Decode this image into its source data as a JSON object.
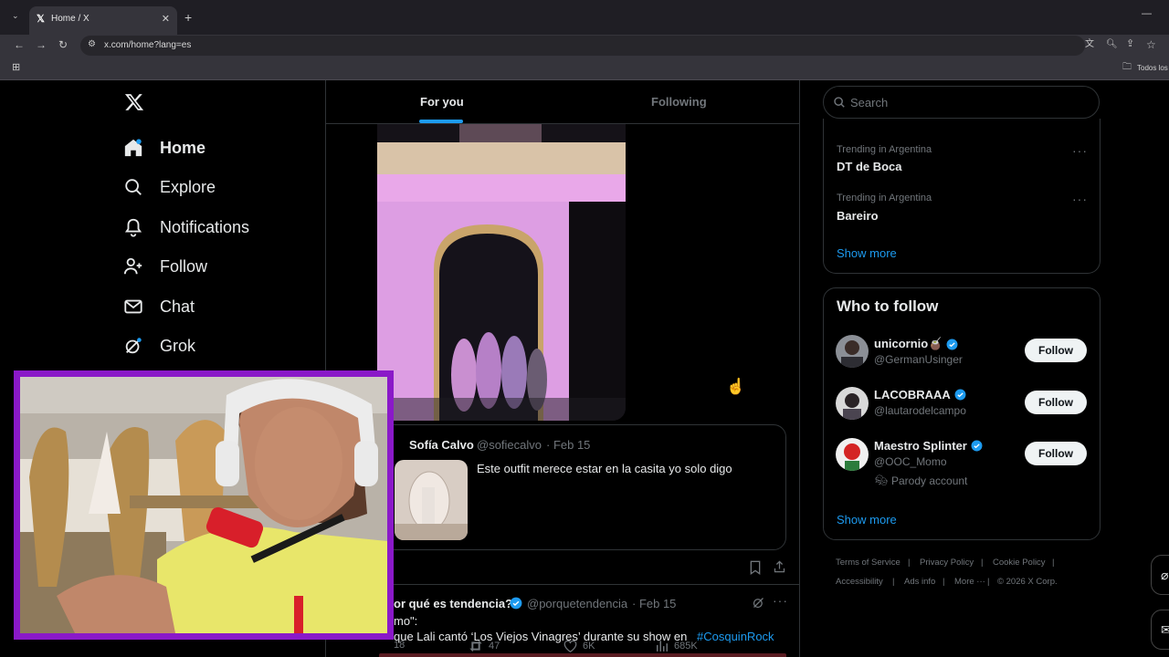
{
  "browser": {
    "tab_title": "Home / X",
    "url": "x.com/home?lang=es",
    "bookmarks_label": "Todos los"
  },
  "nav": {
    "items": [
      {
        "label": "Home",
        "icon": "home-icon"
      },
      {
        "label": "Explore",
        "icon": "search-icon"
      },
      {
        "label": "Notifications",
        "icon": "bell-icon"
      },
      {
        "label": "Follow",
        "icon": "person-add-icon"
      },
      {
        "label": "Chat",
        "icon": "mail-icon"
      },
      {
        "label": "Grok",
        "icon": "grok-icon"
      }
    ]
  },
  "feed": {
    "tabs": [
      "For you",
      "Following"
    ],
    "quoted": {
      "author": "Sofía Calvo",
      "handle": "@sofiecalvo",
      "date": "· Feb 15",
      "text": "Este outfit merece estar en la casita yo solo digo"
    },
    "metrics": {
      "replies": "18",
      "reposts": "47",
      "likes": "6K",
      "views": "685K"
    },
    "next_post": {
      "author": "or qué es tendencia?",
      "handle": "@porquetendencia",
      "date": "· Feb 15",
      "line1": "mo\":",
      "line2": "que Lali cantó ‘Los Viejos Vinagres’ durante su show en",
      "hashtag": "#CosquinRock"
    }
  },
  "sidebar": {
    "search_placeholder": "Search",
    "trends": [
      {
        "meta": "Trending in Argentina",
        "title": "DT de Boca"
      },
      {
        "meta": "Trending in Argentina",
        "title": "Bareiro"
      }
    ],
    "show_more": "Show more",
    "who_to_follow_title": "Who to follow",
    "suggestions": [
      {
        "name": "unicornio🧉",
        "handle": "@GermanUsinger",
        "extra": ""
      },
      {
        "name": "LACOBRAAA",
        "handle": "@lautarodelcampo",
        "extra": ""
      },
      {
        "name": "Maestro Splinter",
        "handle": "@OOC_Momo",
        "extra": "Parody account"
      }
    ],
    "follow_label": "Follow",
    "footer": {
      "terms": "Terms of Service",
      "privacy": "Privacy Policy",
      "cookie": "Cookie Policy",
      "accessibility": "Accessibility",
      "ads": "Ads info",
      "more": "More ···",
      "copyright": "© 2026 X Corp."
    }
  },
  "colors": {
    "accent": "#1d9bf0",
    "stream_frame": "#8a19c8"
  }
}
